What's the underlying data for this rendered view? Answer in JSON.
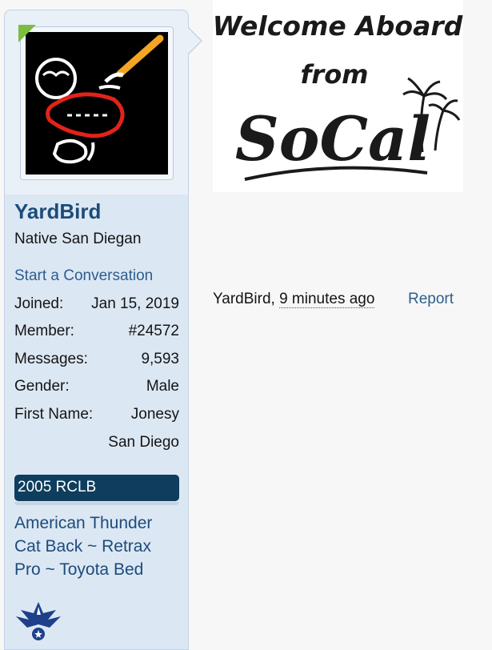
{
  "user": {
    "name": "YardBird",
    "title": "Native San Diegan",
    "start_conversation": "Start a Conversation",
    "info": [
      {
        "label": "Joined:",
        "value": "Jan 15, 2019"
      },
      {
        "label": "Member:",
        "value": "#24572"
      },
      {
        "label": "Messages:",
        "value": "9,593"
      },
      {
        "label": "Gender:",
        "value": "Male"
      },
      {
        "label": "First Name:",
        "value": "Jonesy"
      },
      {
        "label": "",
        "value": "San Diego"
      }
    ],
    "vehicle_banner": "2005 RCLB",
    "mods": [
      "American Thunder",
      "Cat Back ~ Retrax",
      "Pro ~ Toyota Bed"
    ]
  },
  "post": {
    "signature_lines": [
      "Welcome Aboard",
      "from",
      "SoCal"
    ],
    "author": "YardBird",
    "separator": ", ",
    "time_ago": "9 minutes ago",
    "report_label": "Report"
  },
  "colors": {
    "sidebar_bg": "#dce7f4",
    "username": "#1d4b7a",
    "link": "#2d5e8e",
    "banner": "#0f3d5e",
    "online": "#7bbd3f"
  },
  "icons": [
    "online-indicator-icon",
    "padre-logo-avatar",
    "air-force-wings-icon"
  ]
}
